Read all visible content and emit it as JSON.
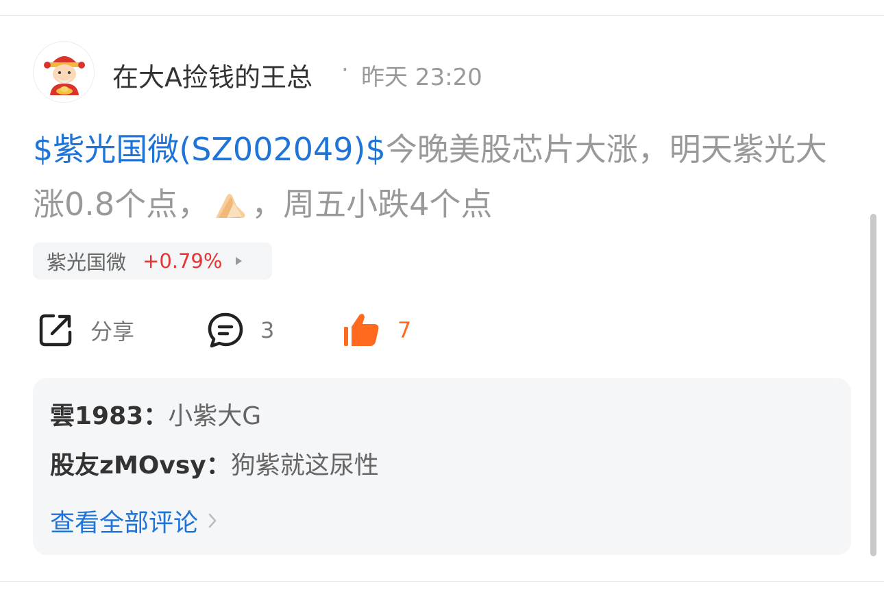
{
  "post": {
    "author": "在大A捡钱的王总",
    "separator": "·",
    "time": "昨天 23:20",
    "stock_tag": "$紫光国微(SZ002049)$",
    "content_part1": "今晚美股芯片大涨，明天紫光大涨0.8个点，",
    "content_part2": "，周五小跌4个点",
    "emoji_icon": "palms-together-emoji"
  },
  "stock_chip": {
    "name": "紫光国微",
    "change": "+0.79%",
    "change_color": "#e53535"
  },
  "actions": {
    "share_label": "分享",
    "comment_count": "3",
    "like_count": "7",
    "like_color": "#ff6a1f"
  },
  "comments": [
    {
      "user": "雲1983：",
      "text": "小紫大G"
    },
    {
      "user": "股友zMOvsy：",
      "text": "狗紫就这尿性"
    }
  ],
  "view_all_label": "查看全部评论",
  "colors": {
    "link_blue": "#1f74d8",
    "text_gray": "#999999"
  }
}
